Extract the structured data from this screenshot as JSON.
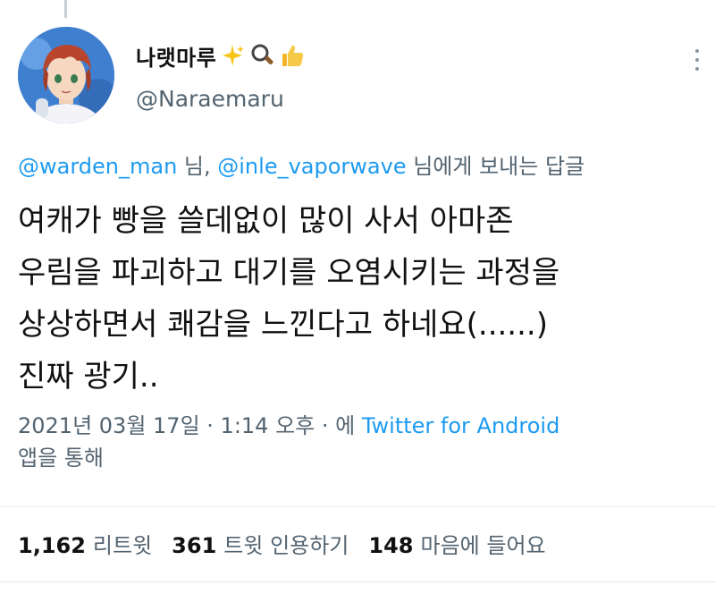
{
  "author": {
    "display_name": "나랫마루",
    "handle": "@Naraemaru",
    "name_emojis": [
      "sparkles-emoji",
      "magnifier-emoji",
      "thumbs-up-emoji"
    ]
  },
  "reply_to": {
    "mention_1": "@warden_man",
    "separator": " 님, ",
    "mention_2": "@inle_vaporwave",
    "suffix": " 님에게 보내는 답글"
  },
  "tweet": {
    "lines": [
      "여캐가 빵을 쓸데없이 많이 사서 아마존",
      "우림을 파괴하고 대기를 오염시키는 과정을",
      "상상하면서 쾌감을 느낀다고 하네요(......)",
      "진짜 광기.."
    ]
  },
  "meta": {
    "date": "2021년 03월 17일",
    "dot1": " · ",
    "time": "1:14 오후",
    "dot2": " · 에 ",
    "source": "Twitter for Android",
    "suffix": "앱을 통해"
  },
  "stats": {
    "retweets_count": "1,162",
    "retweets_label": "리트윗",
    "quotes_count": "361",
    "quotes_label": "트윗 인용하기",
    "likes_count": "148",
    "likes_label": "마음에 들어요"
  },
  "colors": {
    "link": "#1d9bf0",
    "secondary_text": "#536471",
    "primary_text": "#111111"
  }
}
